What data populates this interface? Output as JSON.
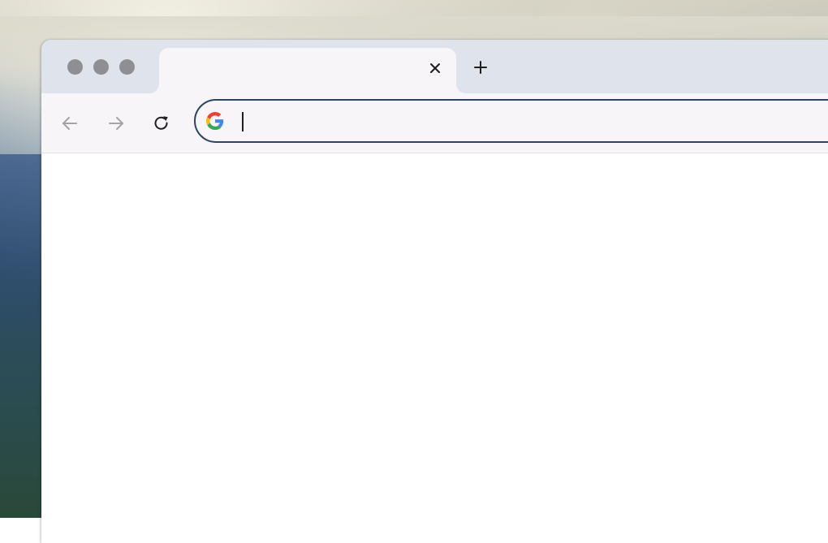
{
  "browser": {
    "tab": {
      "title": "",
      "close_icon": "close-icon"
    },
    "new_tab_icon": "plus-icon",
    "toolbar": {
      "back_icon": "arrow-left-icon",
      "forward_icon": "arrow-right-icon",
      "reload_icon": "reload-icon"
    },
    "omnibox": {
      "value": "",
      "placeholder": "",
      "engine_icon": "google-g-icon"
    }
  },
  "colors": {
    "tabstrip": "#dee3ec",
    "toolbar": "#f7f5f7",
    "omnibox_border": "#2e4463",
    "traffic_lights": "#8d8f93"
  }
}
